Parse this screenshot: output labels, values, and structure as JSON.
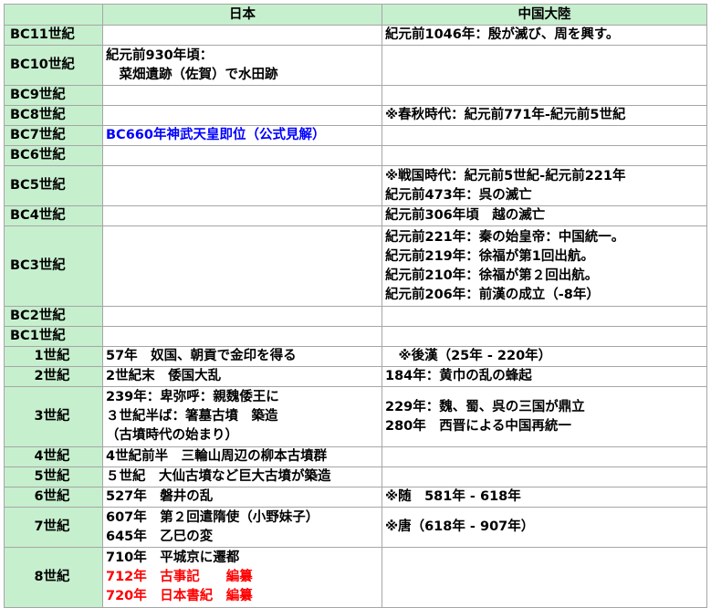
{
  "headers": {
    "era": "",
    "japan": "日本",
    "china": "中国大陸"
  },
  "rows": [
    {
      "era": "BC11世紀",
      "japan": [],
      "china": [
        "紀元前1046年：殷が滅び、周を興す。"
      ]
    },
    {
      "era": "BC10世紀",
      "japan": [
        "紀元前930年頃：",
        "　菜畑遺跡（佐賀）で水田跡"
      ],
      "china": []
    },
    {
      "era": "BC9世紀",
      "japan": [],
      "china": []
    },
    {
      "era": "BC8世紀",
      "japan": [],
      "china": [
        "※春秋時代：紀元前771年-紀元前5世紀"
      ]
    },
    {
      "era": "BC7世紀",
      "japan": [
        "BC660年神武天皇即位（公式見解）"
      ],
      "china": []
    },
    {
      "era": "BC6世紀",
      "japan": [],
      "china": []
    },
    {
      "era": "BC5世紀",
      "japan": [],
      "china": [
        "※戦国時代：紀元前5世紀-紀元前221年",
        "紀元前473年：呉の滅亡"
      ]
    },
    {
      "era": "BC4世紀",
      "japan": [],
      "china": [
        "紀元前306年頃　越の滅亡"
      ]
    },
    {
      "era": "BC3世紀",
      "japan": [],
      "china": [
        "紀元前221年：秦の始皇帝：中国統一。",
        "紀元前219年：徐福が第1回出航。",
        "紀元前210年：徐福が第２回出航。",
        "紀元前206年：前漢の成立（-8年）"
      ]
    },
    {
      "era": "BC2世紀",
      "japan": [],
      "china": []
    },
    {
      "era": "BC1世紀",
      "japan": [],
      "china": []
    },
    {
      "era": "1世紀",
      "japan": [
        "57年　奴国、朝貢で金印を得る"
      ],
      "china": [
        "　※後漢（25年 - 220年）"
      ]
    },
    {
      "era": "2世紀",
      "japan": [
        "2世紀末　倭国大乱"
      ],
      "china": [
        "184年：黄巾の乱の蜂起"
      ]
    },
    {
      "era": "3世紀",
      "japan": [
        "239年：卑弥呼：親魏倭王に",
        "３世紀半ば：箸墓古墳　築造",
        "（古墳時代の始まり）"
      ],
      "china": [
        "229年：魏、蜀、呉の三国が鼎立",
        "280年　西晋による中国再統一"
      ]
    },
    {
      "era": "4世紀",
      "japan": [
        "4世紀前半　三輪山周辺の柳本古墳群"
      ],
      "china": []
    },
    {
      "era": "5世紀",
      "japan": [
        "５世紀　大仙古墳など巨大古墳が築造"
      ],
      "china": []
    },
    {
      "era": "6世紀",
      "japan": [
        "527年　磐井の乱"
      ],
      "china": [
        "※随　581年 - 618年"
      ]
    },
    {
      "era": "7世紀",
      "japan": [
        "607年　第２回遣隋使（小野妹子）",
        "645年　乙巳の変"
      ],
      "china": [
        "※唐（618年 - 907年）"
      ]
    },
    {
      "era": "8世紀",
      "japan": [
        "710年　平城京に遷都",
        "712年　古事記　　編纂",
        "720年　日本書紀　編纂"
      ],
      "china": []
    }
  ],
  "colors": {
    "header_bg": "#c6efce",
    "grid": "#a6a6a6",
    "blue_text": "#0000ff",
    "red_text": "#ff0000"
  }
}
